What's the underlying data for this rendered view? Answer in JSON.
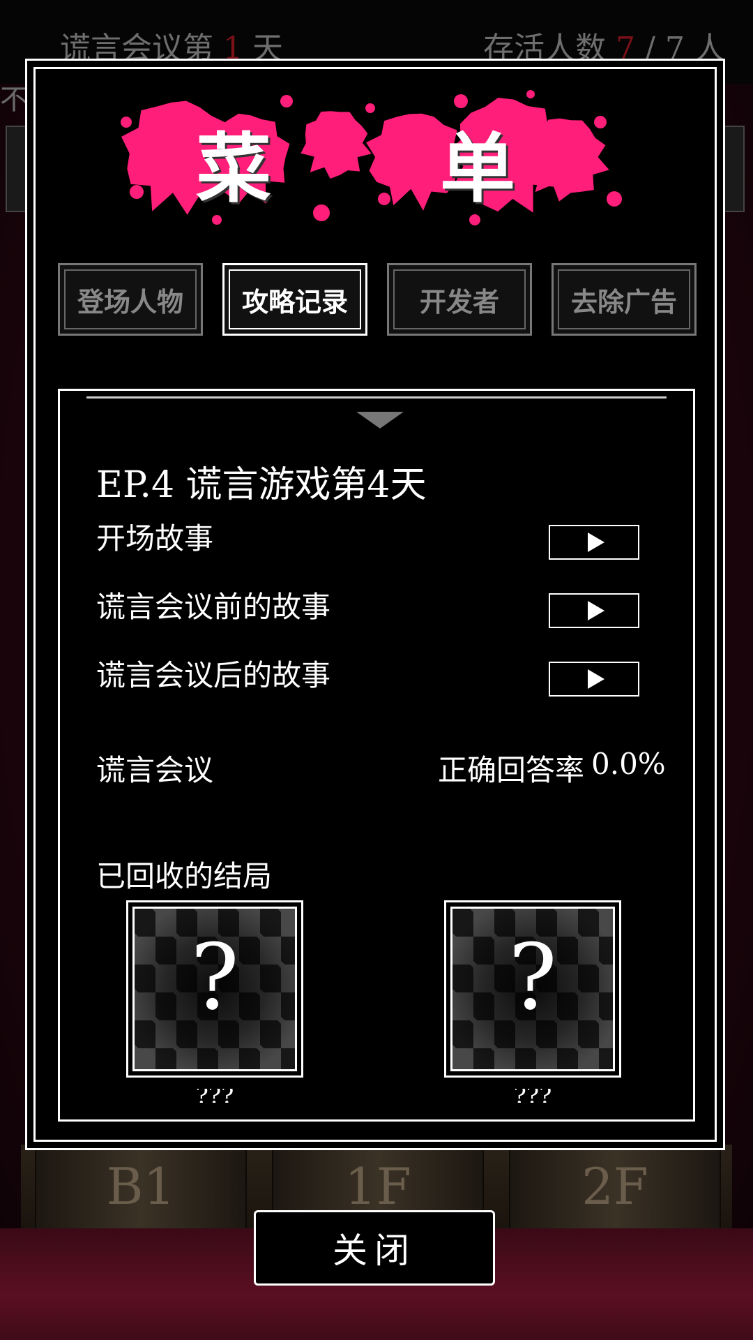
{
  "background": {
    "meeting_prefix": "谎言会议第",
    "meeting_day": "1",
    "meeting_suffix": "天",
    "survivors_label": "存活人数",
    "survivors_alive": "7",
    "survivors_sep": "/",
    "survivors_total": "7",
    "survivors_unit": "人",
    "side_text": "不",
    "floors": [
      "B1",
      "1F",
      "2F"
    ]
  },
  "menu": {
    "title_chars": [
      "菜",
      "单"
    ],
    "splat_color": "#ff1f7a",
    "tabs": [
      {
        "label": "登场人物",
        "active": false
      },
      {
        "label": "攻略记录",
        "active": true
      },
      {
        "label": "开发者",
        "active": false
      },
      {
        "label": "去除广告",
        "active": false
      }
    ],
    "episode": {
      "title": "EP.4  谎言游戏第4天",
      "stories": [
        {
          "label": "开场故事"
        },
        {
          "label": "谎言会议前的故事"
        },
        {
          "label": "谎言会议后的故事"
        }
      ],
      "meeting_label": "谎言会议",
      "accuracy_label": "正确回答率",
      "accuracy_value": "0.0%",
      "endings_label": "已回收的结局",
      "endings": [
        {
          "symbol": "?",
          "caption": "???"
        },
        {
          "symbol": "?",
          "caption": "???"
        }
      ]
    }
  },
  "close_label": "关闭"
}
